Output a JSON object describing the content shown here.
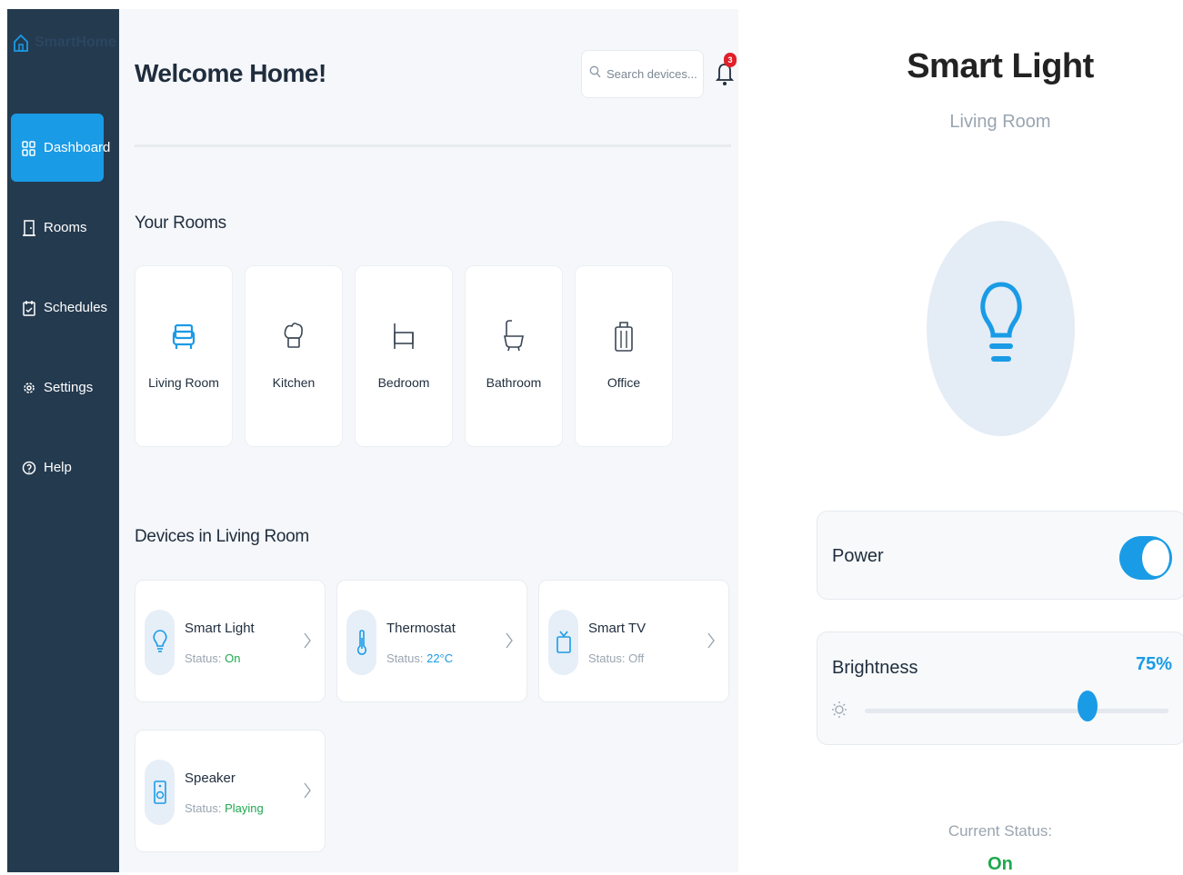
{
  "sidebar": {
    "logo_text": "SmartHome",
    "items": [
      {
        "label": "Dashboard",
        "icon": "dashboard-icon",
        "active": true
      },
      {
        "label": "Rooms",
        "icon": "door-icon",
        "active": false
      },
      {
        "label": "Schedules",
        "icon": "calendar-icon",
        "active": false
      },
      {
        "label": "Settings",
        "icon": "gear-icon",
        "active": false
      },
      {
        "label": "Help",
        "icon": "help-icon",
        "active": false
      }
    ]
  },
  "header": {
    "title": "Welcome Home!",
    "search_placeholder": "Search devices...",
    "notification_count": "3"
  },
  "rooms": {
    "title": "Your Rooms",
    "items": [
      {
        "label": "Living Room",
        "icon": "sofa-icon",
        "active": true
      },
      {
        "label": "Kitchen",
        "icon": "chef-hat-icon",
        "active": false
      },
      {
        "label": "Bedroom",
        "icon": "bed-icon",
        "active": false
      },
      {
        "label": "Bathroom",
        "icon": "bathtub-icon",
        "active": false
      },
      {
        "label": "Office",
        "icon": "briefcase-icon",
        "active": false
      }
    ]
  },
  "devices": {
    "title": "Devices in Living Room",
    "items": [
      {
        "name": "Smart Light",
        "status_prefix": "Status:",
        "status_value": "On",
        "status_color": "#1fa84f",
        "icon": "lightbulb-icon"
      },
      {
        "name": "Thermostat",
        "status_prefix": "Status:",
        "status_value": "22°C",
        "status_color": "#1a9be6",
        "icon": "thermometer-icon"
      },
      {
        "name": "Smart TV",
        "status_prefix": "Status:",
        "status_value": "Off",
        "status_color": "#9aa5b1",
        "icon": "tv-icon"
      },
      {
        "name": "Speaker",
        "status_prefix": "Status:",
        "status_value": "Playing",
        "status_color": "#1fa84f",
        "icon": "speaker-icon"
      }
    ]
  },
  "panel": {
    "title": "Smart Light",
    "room": "Living Room",
    "icon": "lightbulb-icon",
    "power_label": "Power",
    "power_on": true,
    "brightness_label": "Brightness",
    "brightness_value": "75%",
    "brightness_level": 0.75,
    "current_status_label": "Current Status:",
    "current_status_value": "On"
  },
  "colors": {
    "sidebar_bg": "#243a4f",
    "accent": "#1a9be6",
    "status_on": "#1fa84f",
    "badge": "#e0202a"
  }
}
